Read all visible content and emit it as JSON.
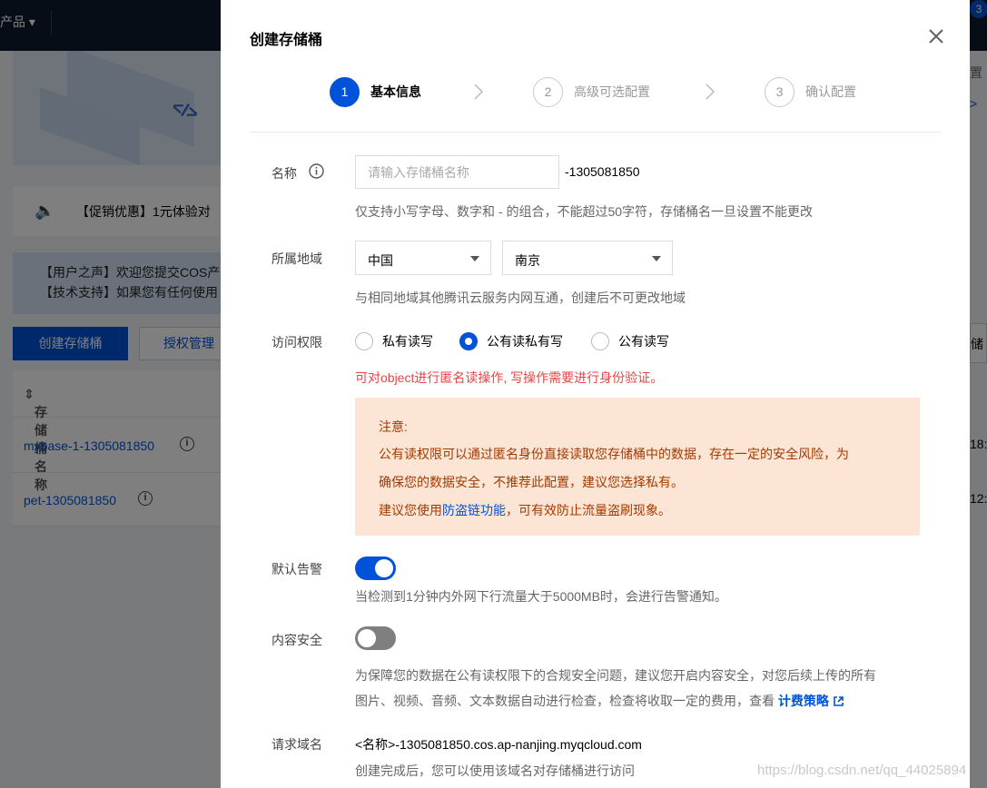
{
  "background": {
    "topbar_product": "产品 ▾",
    "notification_count": "3",
    "promo_text": "【促销优惠】1元体验对",
    "notice_line1": "【用户之声】欢迎您提交COS产",
    "notice_line2": "【技术支持】如果您有任何使用",
    "create_bucket_button": "创建存储桶",
    "auth_manage_button": "授权管理",
    "table_header": "存储桶名称",
    "rows": [
      {
        "name": "mybase-1-1305081850"
      },
      {
        "name": "pet-1305081850"
      }
    ],
    "right_cut": {
      "r1": "置",
      "r2": ">",
      "r3": "储",
      "t1": "18:",
      "t2": "12:0"
    }
  },
  "modal": {
    "title": "创建存储桶",
    "steps": [
      {
        "num": "1",
        "label": "基本信息",
        "active": true
      },
      {
        "num": "2",
        "label": "高级可选配置",
        "active": false
      },
      {
        "num": "3",
        "label": "确认配置",
        "active": false
      }
    ],
    "name": {
      "label": "名称",
      "placeholder": "请输入存储桶名称",
      "suffix": "-1305081850",
      "help": "仅支持小写字母、数字和 - 的组合，不能超过50字符，存储桶名一旦设置不能更改"
    },
    "region": {
      "label": "所属地域",
      "country": "中国",
      "city": "南京",
      "help": "与相同地域其他腾讯云服务内网互通，创建后不可更改地域"
    },
    "access": {
      "label": "访问权限",
      "options": [
        {
          "label": "私有读写",
          "checked": false
        },
        {
          "label": "公有读私有写",
          "checked": true
        },
        {
          "label": "公有读写",
          "checked": false
        }
      ],
      "warning": "可对object进行匿名读操作, 写操作需要进行身份验证。",
      "alert": {
        "title": "注意:",
        "line1": "公有读权限可以通过匿名身份直接读取您存储桶中的数据，存在一定的安全风险，为",
        "line2": "确保您的数据安全，不推荐此配置，建议您选择私有。",
        "line3_pre": "建议您使用",
        "line3_link": "防盗链功能",
        "line3_post": "，可有效防止流量盗刷现象。"
      }
    },
    "alarm": {
      "label": "默认告警",
      "on": true,
      "help": "当检测到1分钟内外网下行流量大于5000MB时，会进行告警通知。"
    },
    "content_security": {
      "label": "内容安全",
      "on": false,
      "help_line1": "为保障您的数据在公有读权限下的合规安全问题，建议您开启内容安全，对您后续上传的所有",
      "help_line2": "图片、视频、音频、文本数据自动进行检查，检查将收取一定的费用，查看",
      "fee_link": "计费策略"
    },
    "domain": {
      "label": "请求域名",
      "value": "<名称>-1305081850.cos.ap-nanjing.myqcloud.com",
      "help": "创建完成后，您可以使用该域名对存储桶进行访问"
    }
  },
  "watermark": "https://blog.csdn.net/qq_44025894",
  "colors": {
    "primary": "#0052d9",
    "danger": "#e54545",
    "alert_bg": "#fde5d6",
    "alert_text": "#a33a00"
  }
}
